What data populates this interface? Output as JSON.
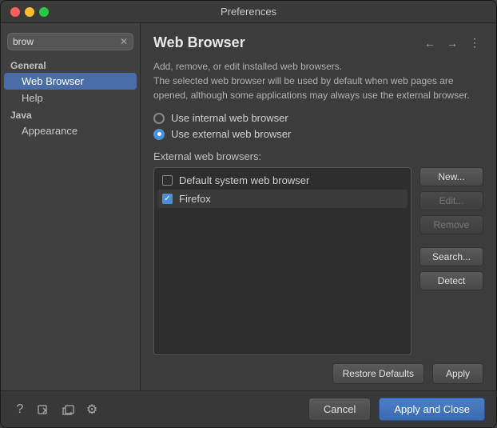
{
  "window": {
    "title": "Preferences"
  },
  "sidebar": {
    "search_placeholder": "brow",
    "groups": [
      {
        "label": "General",
        "items": [
          {
            "id": "web-browser",
            "label": "Web Browser",
            "selected": true
          },
          {
            "id": "help",
            "label": "Help",
            "selected": false
          }
        ]
      },
      {
        "label": "Java",
        "items": [
          {
            "id": "appearance",
            "label": "Appearance",
            "selected": false
          }
        ]
      }
    ]
  },
  "content": {
    "title": "Web Browser",
    "description": "Add, remove, or edit installed web browsers.\nThe selected web browser will be used by default when web pages are\nopened, although some applications may always use the external browser.",
    "use_internal_label": "Use internal web browser",
    "use_external_label": "Use external web browser",
    "external_browsers_label": "External web browsers:",
    "browsers": [
      {
        "id": "default-system",
        "label": "Default system web browser",
        "checked": false
      },
      {
        "id": "firefox",
        "label": "Firefox",
        "checked": true
      }
    ],
    "buttons": {
      "new": "New...",
      "edit": "Edit...",
      "remove": "Remove",
      "search": "Search...",
      "detect": "Detect"
    },
    "restore_defaults": "Restore Defaults",
    "apply": "Apply"
  },
  "footer": {
    "cancel": "Cancel",
    "apply_close": "Apply and Close"
  },
  "icons": {
    "back": "←",
    "forward": "→",
    "menu": "⋮",
    "help": "?",
    "export1": "⎋",
    "export2": "⎋",
    "settings": "⚙"
  }
}
